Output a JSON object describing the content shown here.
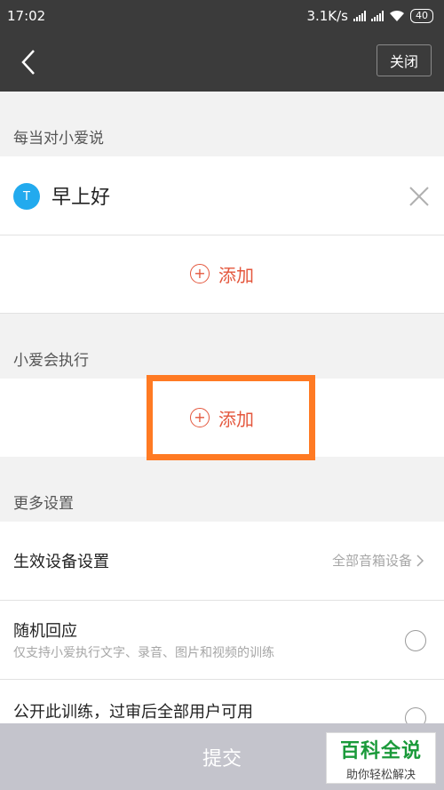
{
  "status_bar": {
    "time": "17:02",
    "net_speed": "3.1K/s",
    "battery": "40"
  },
  "nav": {
    "close_label": "关闭",
    "back_icon": "back-arrow-icon"
  },
  "trigger_section": {
    "title": "每当对小爱说",
    "item": {
      "icon_letter": "T",
      "text": "早上好"
    },
    "add_label": "添加"
  },
  "action_section": {
    "title": "小爱会执行",
    "add_label": "添加"
  },
  "more_section": {
    "title": "更多设置",
    "device_setting": {
      "label": "生效设备设置",
      "value": "全部音箱设备"
    },
    "random_reply": {
      "label": "随机回应",
      "sub": "仅支持小爱执行文字、录音、图片和视频的训练",
      "checked": false
    },
    "public_training": {
      "label": "公开此训练，过审后全部用户可用",
      "checked": false
    }
  },
  "submit": {
    "label": "提交"
  },
  "watermark": {
    "title": "百科全说",
    "subtitle": "助你轻松解决"
  },
  "colors": {
    "accent": "#e4573d",
    "highlight": "#ff7a23",
    "header": "#3b3b3b",
    "t_icon": "#22aaee"
  }
}
